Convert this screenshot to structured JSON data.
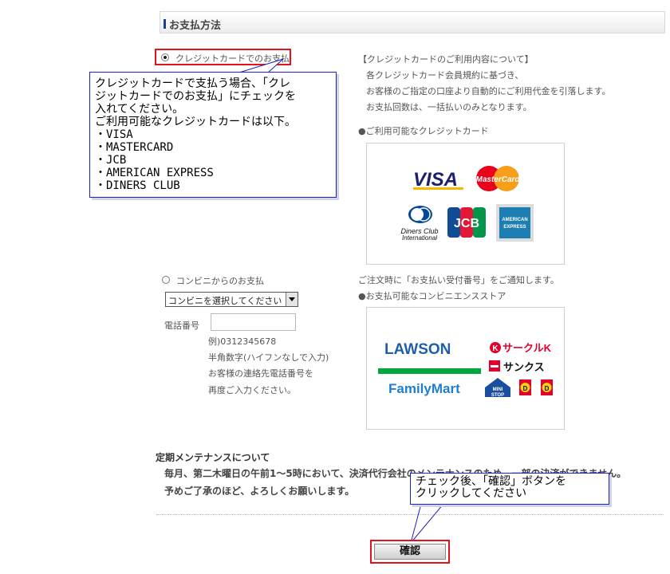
{
  "section": {
    "title": "お支払方法"
  },
  "credit": {
    "radio_label": "クレジットカードでのお支払",
    "selected": true,
    "info_title": "【クレジットカードのご利用内容について】",
    "info_lines": [
      "各クレジットカード会員規約に基づき、",
      "お客様のご指定の口座より自動的にご利用代金を引落します。",
      "お支払回数は、一括払いのみとなります。"
    ],
    "cards_heading": "●ご利用可能なクレジットカード",
    "logos": {
      "visa": "VISA",
      "mastercard": "MasterCard",
      "diners_1": "Diners Club",
      "diners_2": "International",
      "jcb": "JCB",
      "amex_1": "AMERICAN",
      "amex_2": "EXPRESS"
    }
  },
  "callout_credit": {
    "lines": [
      "クレジットカードで支払う場合、「クレ",
      "ジットカードでのお支払」にチェックを",
      "入れてください。",
      "ご利用可能なクレジットカードは以下。",
      "・VISA",
      "・MASTERCARD",
      "・JCB",
      "・AMERICAN EXPRESS",
      "・DINERS CLUB"
    ]
  },
  "convenience": {
    "radio_label": "コンビニからのお支払",
    "selected": false,
    "select_value": "コンビニを選択してください",
    "phone_label": "電話番号",
    "phone_value": "",
    "hints": [
      "例)0312345678",
      "半角数字(ハイフンなしで入力)",
      "お客様の連絡先電話番号を",
      "再度ご入力ください。"
    ],
    "notice": "ご注文時に「お支払い受付番号」をご通知します。",
    "stores_heading": "●お支払可能なコンビニエンスストア",
    "logos": {
      "lawson": "LAWSON",
      "circlek_mark": "K",
      "circlek": "サークルK",
      "sunkus": "サンクス",
      "familymart": "FamilyMart",
      "ministop_1": "MINI",
      "ministop_2": "STOP",
      "daily": "D"
    }
  },
  "maintenance": {
    "title": "定期メンテナンスについて",
    "line1": "毎月、第二木曜日の午前1〜5時において、決済代行会社のメンテナンスのため、一部の決済ができません。",
    "line2": "予めご了承のほど、よろしくお願いします。"
  },
  "callout_confirm": {
    "lines": [
      "チェック後、「確認」ボタンを",
      "クリックしてください"
    ]
  },
  "confirm_button": {
    "label": "確認"
  },
  "colors": {
    "highlight": "#e0141c",
    "callout_border": "#1f1fc8",
    "header_bar": "#1d3d8f"
  }
}
